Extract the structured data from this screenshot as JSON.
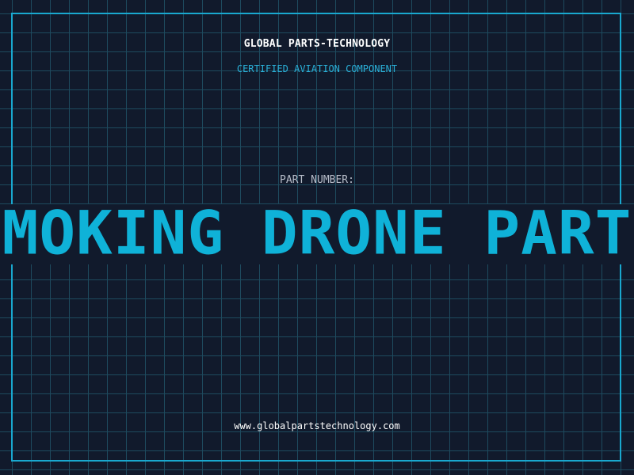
{
  "header": {
    "company": "GLOBAL PARTS-TECHNOLOGY",
    "subtitle": "CERTIFIED AVIATION COMPONENT"
  },
  "part": {
    "label": "PART NUMBER:",
    "value": "SMOKING DRONE PARTS"
  },
  "footer": {
    "website": "www.globalpartstechnology.com"
  },
  "colors": {
    "background": "#111a2c",
    "grid": "#1e4a5e",
    "accent": "#19a8cf",
    "text_primary": "#ffffff",
    "text_muted": "#b6bcc8"
  }
}
